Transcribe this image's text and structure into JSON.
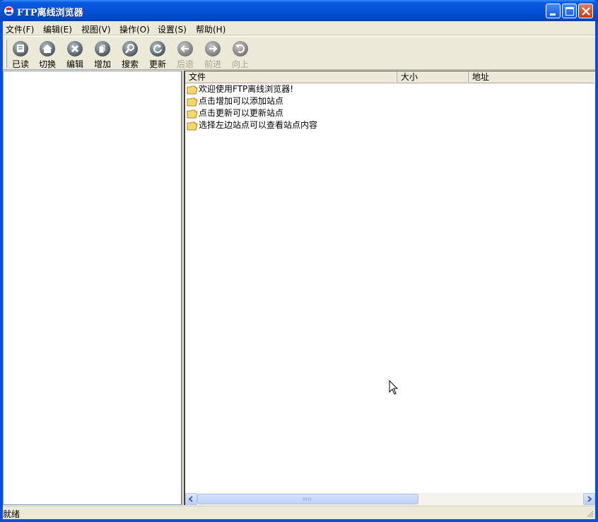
{
  "window": {
    "title": "FTP离线浏览器"
  },
  "menu": [
    {
      "label": "文件(F)"
    },
    {
      "label": "编辑(E)"
    },
    {
      "label": "视图(V)"
    },
    {
      "label": "操作(O)"
    },
    {
      "label": "设置(S)"
    },
    {
      "label": "帮助(H)"
    }
  ],
  "toolbar": [
    {
      "label": "已读",
      "icon": "read-icon",
      "enabled": true
    },
    {
      "label": "切换",
      "icon": "home-icon",
      "enabled": true
    },
    {
      "label": "编辑",
      "icon": "delete-icon",
      "enabled": true
    },
    {
      "label": "增加",
      "icon": "add-icon",
      "enabled": true
    },
    {
      "label": "搜索",
      "icon": "search-icon",
      "enabled": true
    },
    {
      "label": "更新",
      "icon": "refresh-icon",
      "enabled": true
    },
    {
      "label": "后退",
      "icon": "back-icon",
      "enabled": false
    },
    {
      "label": "前进",
      "icon": "forward-icon",
      "enabled": false
    },
    {
      "label": "向上",
      "icon": "up-icon",
      "enabled": false
    }
  ],
  "columns": [
    {
      "label": "文件"
    },
    {
      "label": "大小"
    },
    {
      "label": "地址"
    }
  ],
  "rows": [
    {
      "name": "欢迎使用FTP离线浏览器!"
    },
    {
      "name": "点击增加可以添加站点"
    },
    {
      "name": "点击更新可以更新站点"
    },
    {
      "name": "选择左边站点可以查看站点内容"
    }
  ],
  "status": {
    "text": "就绪"
  },
  "colors": {
    "titlebar": "#0453d8",
    "chrome": "#ece9d8",
    "folder": "#f5d76e"
  }
}
